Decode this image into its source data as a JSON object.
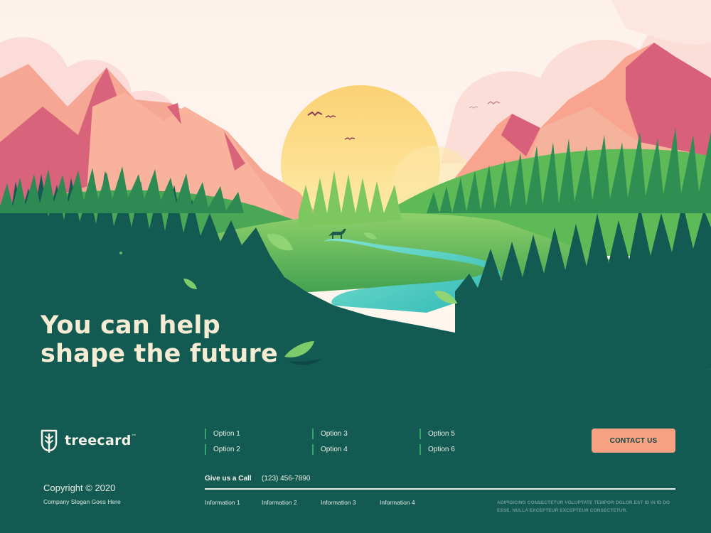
{
  "hero": {
    "headline_line1": "You can help",
    "headline_line2": "shape the future"
  },
  "brand": {
    "name": "treecard",
    "trademark": "™",
    "logo_icon": "tree-leaf-icon"
  },
  "nav": {
    "options": [
      "Option 1",
      "Option 2",
      "Option 3",
      "Option 4",
      "Option 5",
      "Option 6"
    ]
  },
  "cta": {
    "label": "CONTACT US"
  },
  "footer": {
    "copyright": "Copyright © 2020",
    "slogan": "Company Slogan Goes Here",
    "call_label": "Give us a Call",
    "phone": "(123) 456-7890",
    "info_links": [
      "Information 1",
      "Information 2",
      "Information 3",
      "Information 4"
    ],
    "legal_text": "ADIPISICING CONSECTETUR VOLUPTATE TEMPOR DOLOR EST ID IN ID DO ESSE. NULLA EXCEPTEUR EXCEPTEUR CONSECTETUR."
  },
  "colors": {
    "background": "#10504f",
    "accent": "#f7a283",
    "headline": "#f6ecd3",
    "option_marker": "#36a46a"
  }
}
